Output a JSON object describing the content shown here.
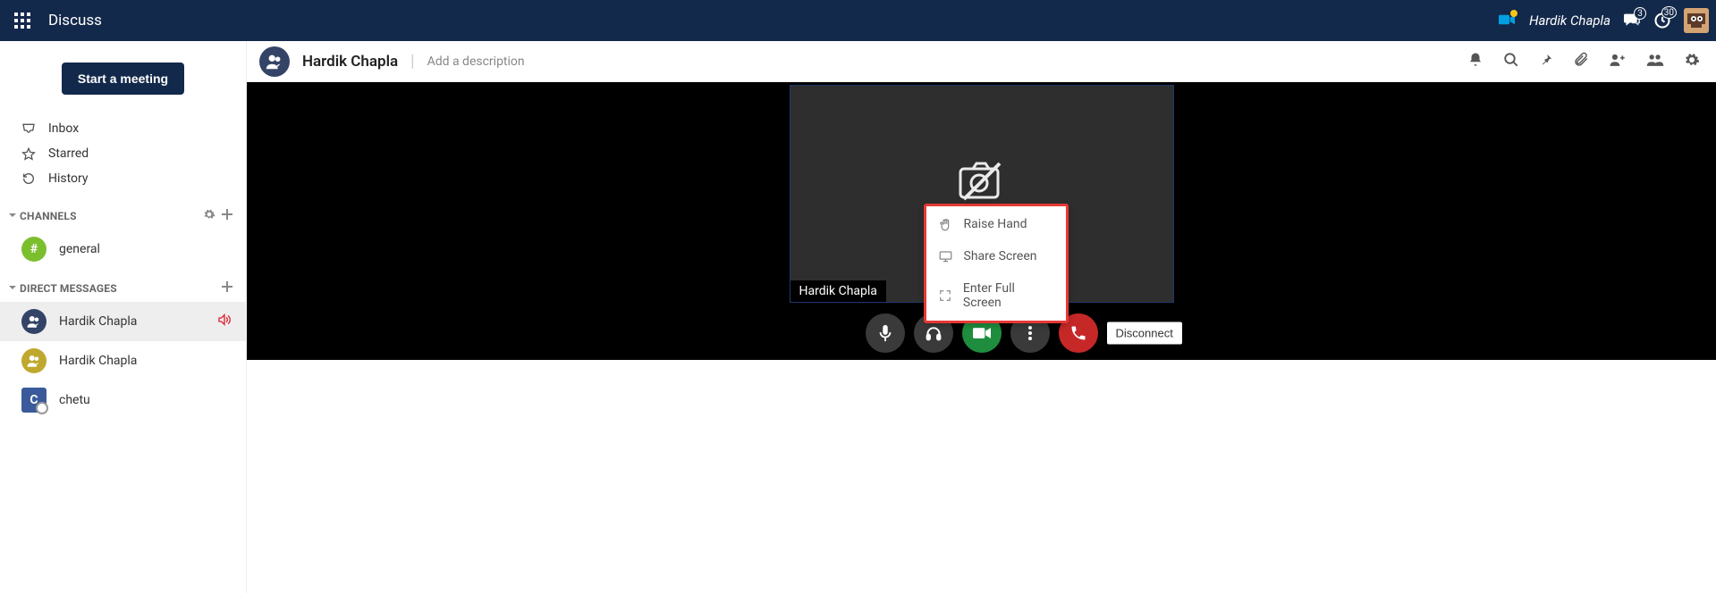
{
  "topnav": {
    "app_title": "Discuss",
    "username": "Hardik Chapla",
    "chat_badge": "3",
    "activity_badge": "30"
  },
  "sidebar": {
    "start_meeting": "Start a meeting",
    "nav": {
      "inbox": "Inbox",
      "starred": "Starred",
      "history": "History"
    },
    "channels_label": "CHANNELS",
    "channel_general": "general",
    "dm_label": "DIRECT MESSAGES",
    "dm1": "Hardik Chapla",
    "dm2": "Hardik Chapla",
    "dm3": "chetu",
    "dm3_initial": "C"
  },
  "chat_header": {
    "title": "Hardik Chapla",
    "add_desc": "Add a description"
  },
  "video": {
    "tile_name": "Hardik Chapla",
    "menu": {
      "raise": "Raise Hand",
      "share": "Share Screen",
      "fullscreen": "Enter Full Screen"
    },
    "disconnect_tooltip": "Disconnect"
  }
}
